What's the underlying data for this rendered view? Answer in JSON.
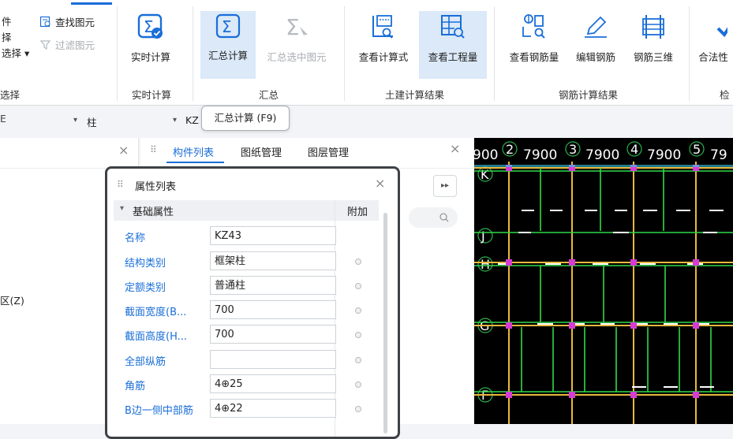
{
  "ribbon": {
    "left_items": [
      "件",
      "择",
      "选择",
      "选择"
    ],
    "find_elem": "查找图元",
    "filter_elem": "过滤图元",
    "realtime_calc": "实时计算",
    "summary_calc": "汇总计算",
    "summary_selected": "汇总选中图元",
    "view_formula": "查看计算式",
    "view_quantity": "查看工程量",
    "view_rebar_qty": "查看钢筋量",
    "edit_rebar": "编辑钢筋",
    "rebar_3d": "钢筋三维",
    "legality": "合法性",
    "groups": {
      "select": "选择",
      "realtime": "实时计算",
      "summary": "汇总",
      "civil_result": "土建计算结果",
      "rebar_result": "钢筋计算结果",
      "check": "检"
    }
  },
  "tooltip": "汇总计算 (F9)",
  "bar2": {
    "first_select": "柱",
    "second_select": "KZ"
  },
  "midpanel": {
    "tabs": [
      "构件列表",
      "图纸管理",
      "图层管理"
    ]
  },
  "leftpanel": {
    "item": "区(Z)"
  },
  "props": {
    "title": "属性列表",
    "section": "基础属性",
    "extra_col": "附加",
    "rows": [
      {
        "label": "名称",
        "value": "KZ43"
      },
      {
        "label": "结构类别",
        "value": "框架柱"
      },
      {
        "label": "定额类别",
        "value": "普通柱"
      },
      {
        "label": "截面宽度(B...",
        "value": "700"
      },
      {
        "label": "截面高度(H...",
        "value": "700"
      },
      {
        "label": "全部纵筋",
        "value": ""
      },
      {
        "label": "角筋",
        "value": "4⊕25"
      },
      {
        "label": "B边一侧中部筋",
        "value": "4⊕22"
      }
    ]
  },
  "cad": {
    "axis_top": [
      {
        "num": "",
        "dim": "900"
      },
      {
        "num": "2",
        "dim": "7900"
      },
      {
        "num": "3",
        "dim": "7900"
      },
      {
        "num": "4",
        "dim": "7900"
      },
      {
        "num": "5",
        "dim": "79"
      }
    ],
    "axis_left": [
      "K",
      "J",
      "H",
      "G",
      "F"
    ]
  }
}
